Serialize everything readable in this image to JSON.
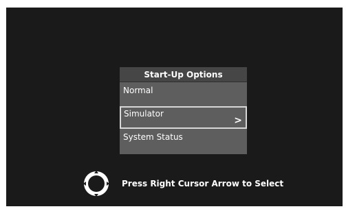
{
  "menu": {
    "title": "Start-Up Options",
    "items": [
      {
        "label": "Normal",
        "selected": false
      },
      {
        "label": "Simulator",
        "selected": true,
        "chevron": ">"
      },
      {
        "label": "System Status",
        "selected": false
      }
    ]
  },
  "hint": {
    "text": "Press Right Cursor Arrow to Select",
    "icon": "dpad-icon"
  },
  "colors": {
    "screen_bg": "#1a1a1a",
    "menu_bg": "#5e5e5e",
    "title_bg": "#464646",
    "highlight_border": "#d8d8d8",
    "text": "#ffffff"
  }
}
